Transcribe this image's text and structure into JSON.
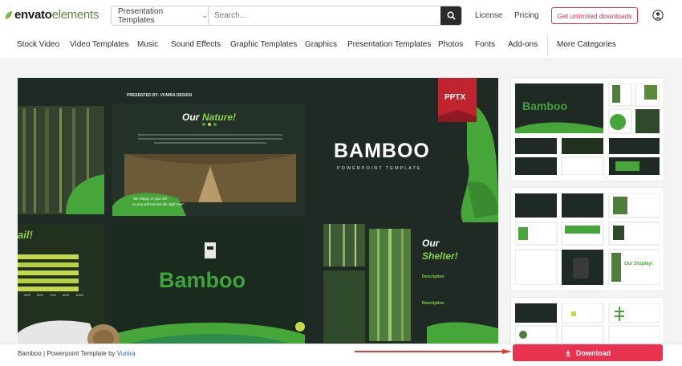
{
  "header": {
    "logo_part1": "envato",
    "logo_part2": "elements",
    "search_category": "Presentation Templates",
    "search_placeholder": "Search...",
    "license": "License",
    "pricing": "Pricing",
    "cta": "Get unlimited downloads"
  },
  "nav": {
    "items": [
      "Stock Video",
      "Video Templates",
      "Music",
      "Sound Effects",
      "Graphic Templates",
      "Graphics",
      "Presentation Templates",
      "Photos",
      "Fonts",
      "Add-ons",
      "More Categories"
    ]
  },
  "preview": {
    "presented_by": "PRESENTED BY: VUNIRA DESIGN",
    "badge": "PPTX",
    "title": "BAMBOO",
    "subtitle": "POWERPOINT TEMPLATE",
    "our_nature_1": "Our",
    "our_nature_2": "Nature!",
    "nature_quote": "\"Be Happy in your life",
    "nature_quote2": "so you will receive life right now\"",
    "bamboo_word": "Bamboo",
    "our_shelter_1": "Our",
    "our_shelter_2": "Shelter!",
    "description": "Description",
    "left_word": "ail!",
    "bars_labels": [
      "30%",
      "50%",
      "70%",
      "90%",
      "100%"
    ]
  },
  "thumbs": {
    "bamboo": "Bamboo",
    "our_display": "Our Display!"
  },
  "footer": {
    "caption_prefix": "Bamboo | Powerpoint Template by ",
    "author": "Vunira",
    "download": "Download"
  },
  "colors": {
    "accent_red": "#e8324f",
    "brand_green": "#5b8a3a",
    "slide_green": "#47a63a",
    "slide_dark": "#1f2a24"
  }
}
